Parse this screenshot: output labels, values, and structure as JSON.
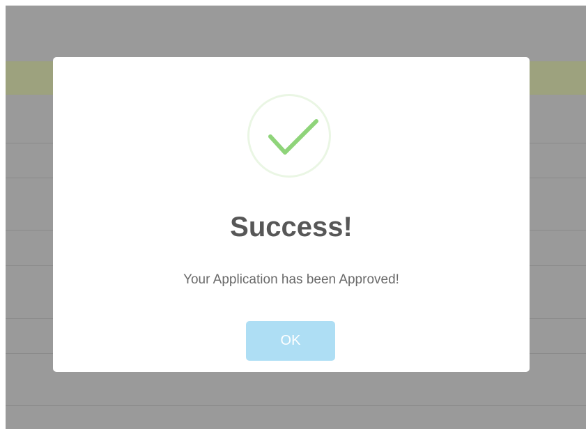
{
  "dialog": {
    "title": "Success!",
    "message": "Your Application has been Approved!",
    "ok_label": "OK",
    "icon": "checkmark-icon"
  },
  "colors": {
    "backdrop": "#9a9a9a",
    "header_band": "#9da27e",
    "check": "#8fd47a",
    "ring": "#eaf6e4",
    "button": "#aedef4",
    "title_text": "#575757",
    "message_text": "#6a6a6a"
  }
}
